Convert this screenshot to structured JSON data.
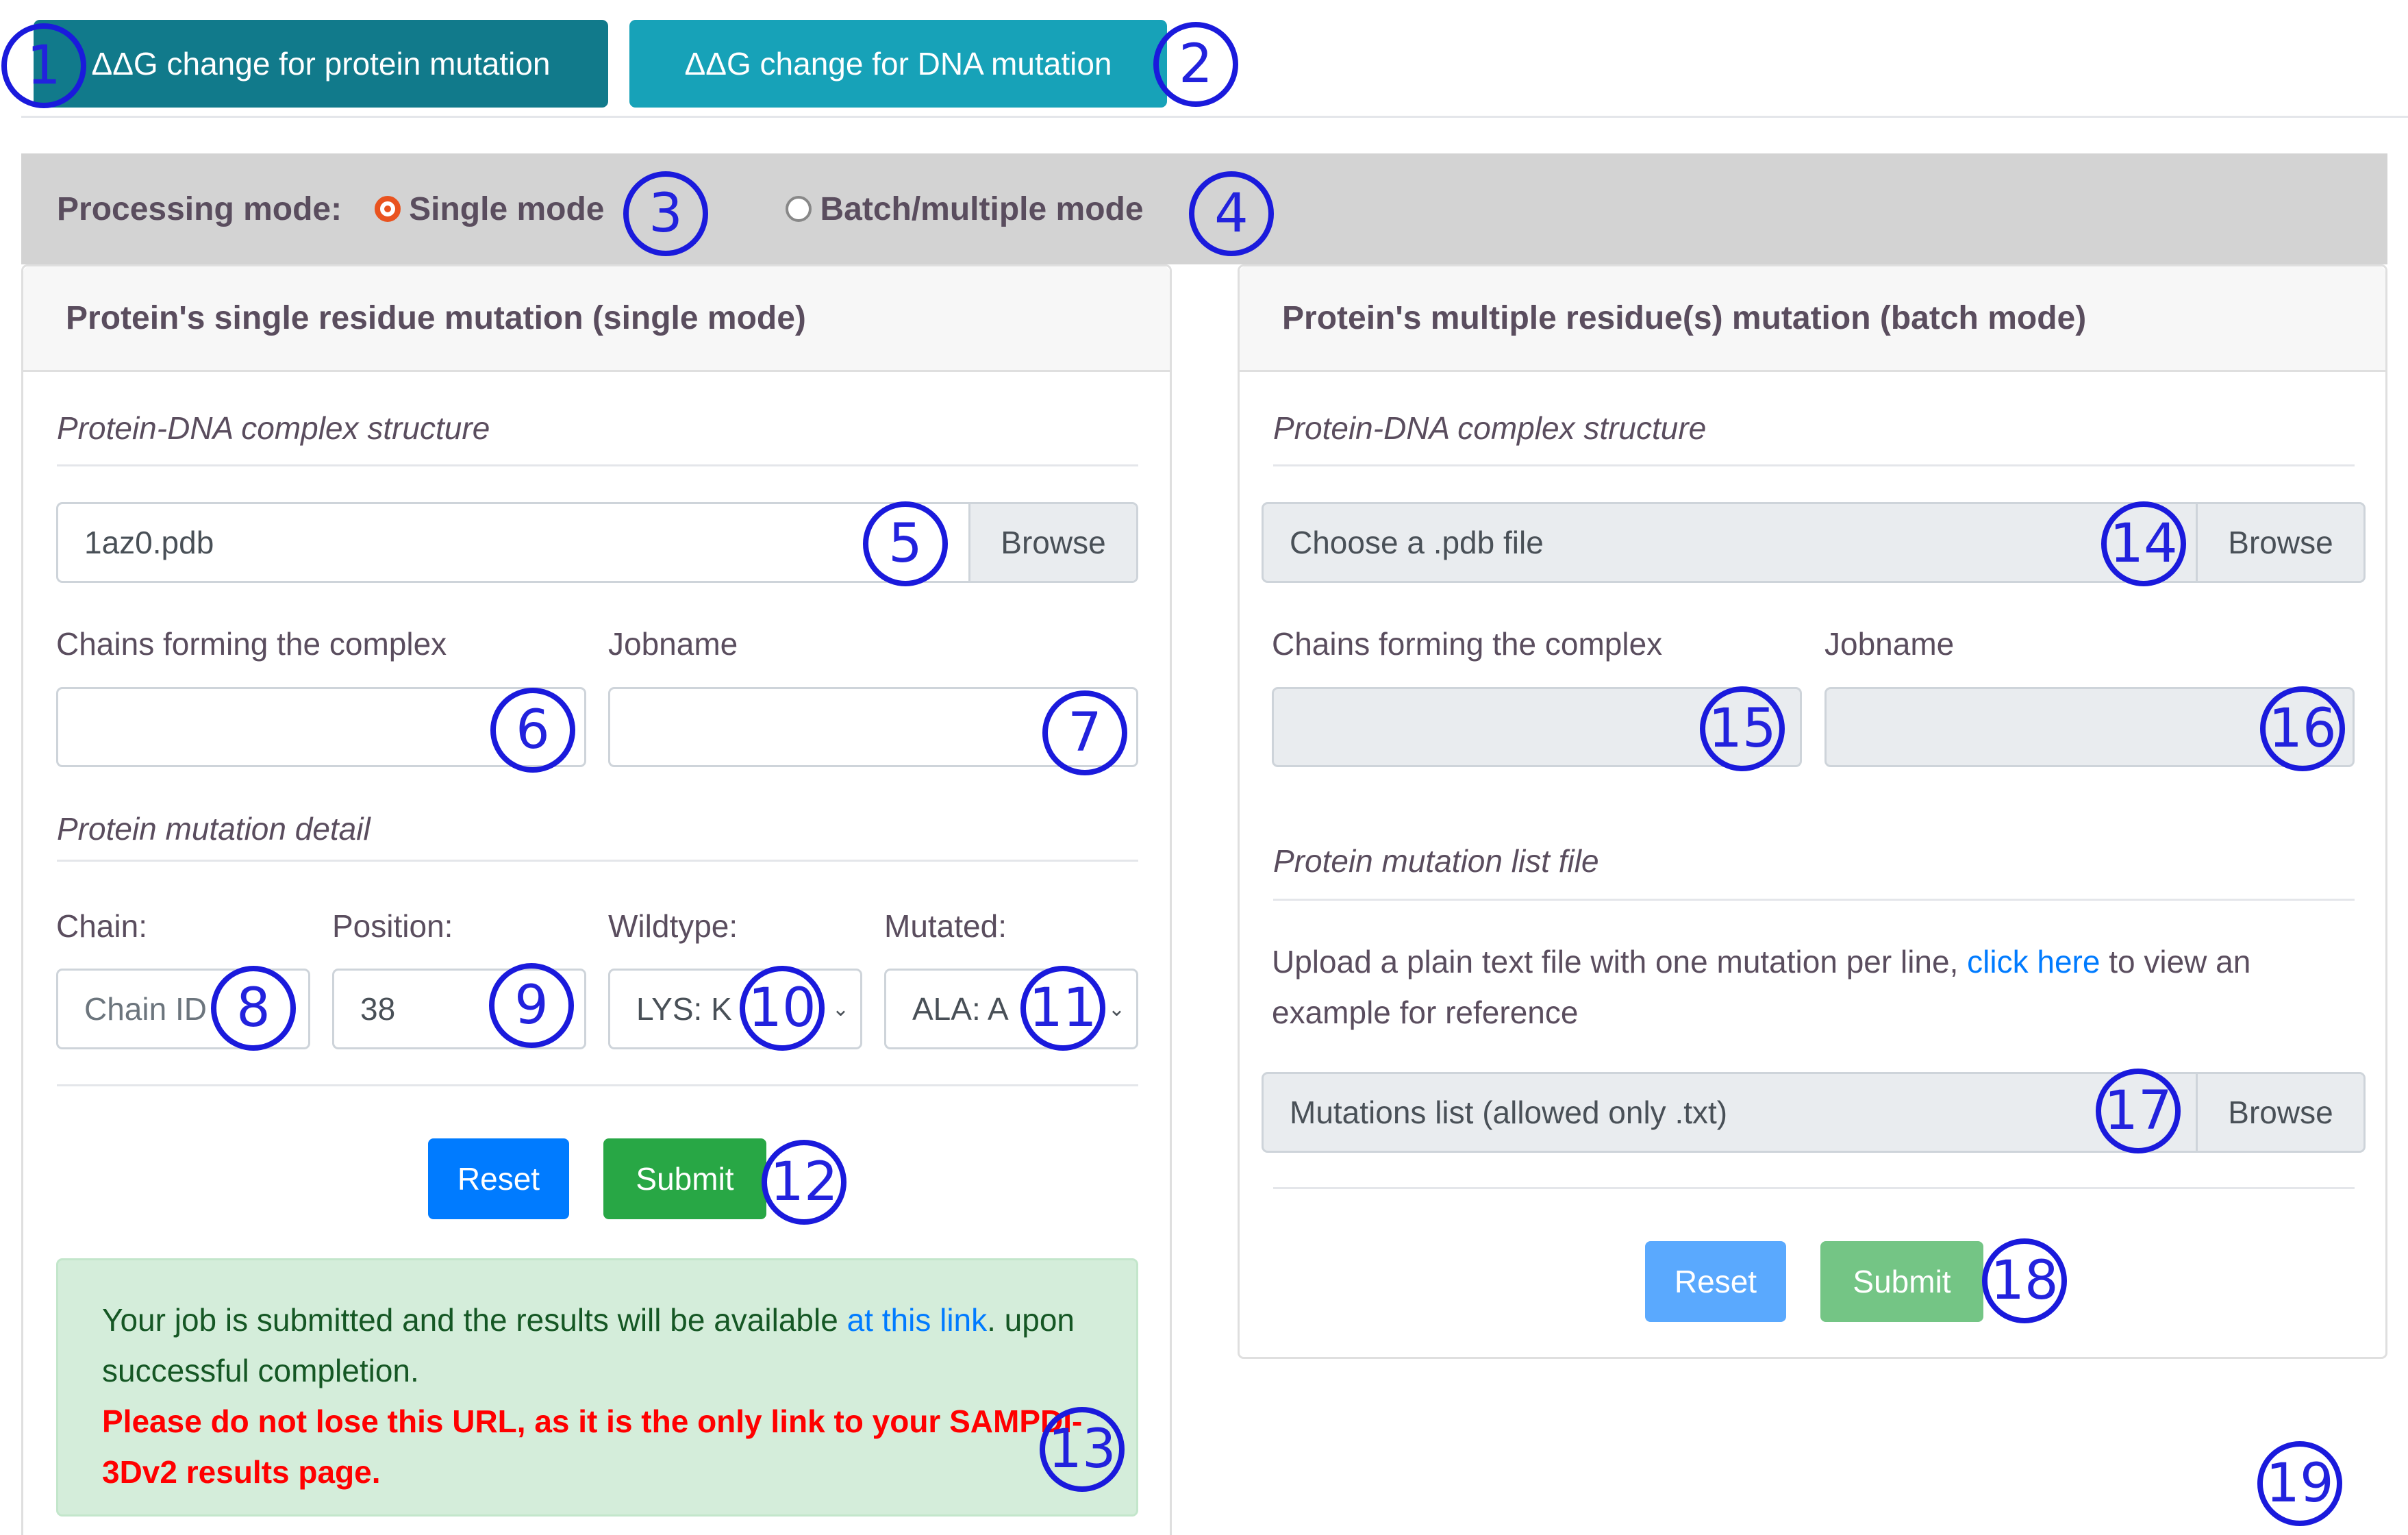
{
  "tabs": [
    {
      "label": "ΔΔG change for protein mutation",
      "active": true
    },
    {
      "label": "ΔΔG change for DNA mutation",
      "active": false
    }
  ],
  "processing_mode": {
    "label": "Processing mode:",
    "options": [
      {
        "label": "Single mode",
        "checked": true
      },
      {
        "label": "Batch/multiple mode",
        "checked": false
      }
    ]
  },
  "single_mode": {
    "header": "Protein's single residue mutation (single mode)",
    "structure_section": "Protein-DNA complex structure",
    "file_name": "1az0.pdb",
    "browse_label": "Browse",
    "chains_label": "Chains forming the complex",
    "chains_value": "",
    "jobname_label": "Jobname",
    "jobname_value": "",
    "mutation_section": "Protein mutation detail",
    "chain_label": "Chain:",
    "chain_placeholder": "Chain ID",
    "position_label": "Position:",
    "position_value": "38",
    "wildtype_label": "Wildtype:",
    "wildtype_value": "LYS: K",
    "mutated_label": "Mutated:",
    "mutated_value": "ALA: A",
    "reset_label": "Reset",
    "submit_label": "Submit",
    "alert": {
      "text_before_link": "Your job is submitted and the results will be available ",
      "link_text": "at this link",
      "text_after_link": ". upon successful completion.",
      "warning": "Please do not lose this URL, as it is the only link to your SAMPDI-3Dv2 results page."
    }
  },
  "batch_mode": {
    "header": "Protein's multiple residue(s) mutation (batch mode)",
    "structure_section": "Protein-DNA complex structure",
    "file_placeholder": "Choose a .pdb file",
    "browse_label": "Browse",
    "chains_label": "Chains forming the complex",
    "jobname_label": "Jobname",
    "list_section": "Protein mutation list file",
    "instructions_before_link": "Upload a plain text file with one mutation per line, ",
    "instructions_link": "click here",
    "instructions_after_link": " to view an example for reference",
    "list_placeholder": "Mutations list (allowed only .txt)",
    "list_browse_label": "Browse",
    "reset_label": "Reset",
    "submit_label": "Submit"
  },
  "markers": [
    "1",
    "2",
    "3",
    "4",
    "5",
    "6",
    "7",
    "8",
    "9",
    "10",
    "11",
    "12",
    "13",
    "14",
    "15",
    "16",
    "17",
    "18",
    "19"
  ]
}
